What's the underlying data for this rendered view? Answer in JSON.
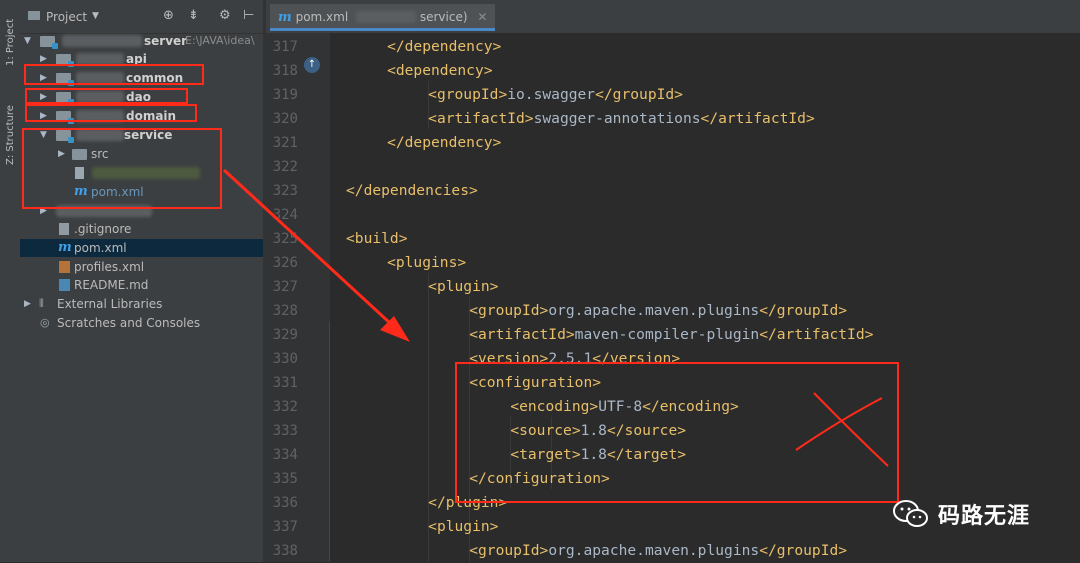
{
  "side_stripe": {
    "project_tab": "1: Project",
    "structure_tab": "Z: Structure"
  },
  "project_panel": {
    "header": {
      "title": "Project"
    },
    "tree": [
      {
        "label": "server",
        "path": "E:\\JAVA\\idea\\"
      },
      {
        "label": "api"
      },
      {
        "label": "common"
      },
      {
        "label": "dao"
      },
      {
        "label": "domain"
      },
      {
        "label": "service"
      },
      {
        "label": "src"
      },
      {
        "label": "pom.xml"
      },
      {
        "label": ".gitignore"
      },
      {
        "label": "pom.xml"
      },
      {
        "label": "profiles.xml"
      },
      {
        "label": "README.md"
      },
      {
        "label": "External Libraries"
      },
      {
        "label": "Scratches and Consoles"
      }
    ]
  },
  "editor_tab": {
    "label": "pom.xml",
    "suffix": "service)"
  },
  "line_numbers": [
    "317",
    "318",
    "319",
    "320",
    "321",
    "322",
    "323",
    "324",
    "325",
    "326",
    "327",
    "328",
    "329",
    "330",
    "331",
    "332",
    "333",
    "334",
    "335",
    "336",
    "337",
    "338"
  ],
  "code_lines": [
    {
      "indent": 4,
      "parts": [
        [
          "tg",
          "</dependency>"
        ]
      ]
    },
    {
      "indent": 4,
      "parts": [
        [
          "tg",
          "<dependency>"
        ]
      ]
    },
    {
      "indent": 8,
      "parts": [
        [
          "tg",
          "<groupId>"
        ],
        [
          "tx",
          "io.swagger"
        ],
        [
          "tg",
          "</groupId>"
        ]
      ]
    },
    {
      "indent": 8,
      "parts": [
        [
          "tg",
          "<artifactId>"
        ],
        [
          "tx",
          "swagger-annotations"
        ],
        [
          "tg",
          "</artifactId>"
        ]
      ]
    },
    {
      "indent": 4,
      "parts": [
        [
          "tg",
          "</dependency>"
        ]
      ]
    },
    {
      "indent": 0,
      "parts": []
    },
    {
      "indent": 0,
      "parts": [
        [
          "tg",
          "</dependencies>"
        ]
      ]
    },
    {
      "indent": 0,
      "parts": []
    },
    {
      "indent": 0,
      "parts": [
        [
          "tg",
          "<build>"
        ]
      ]
    },
    {
      "indent": 4,
      "parts": [
        [
          "tg",
          "<plugins>"
        ]
      ]
    },
    {
      "indent": 8,
      "parts": [
        [
          "tg",
          "<plugin>"
        ]
      ]
    },
    {
      "indent": 12,
      "parts": [
        [
          "tg",
          "<groupId>"
        ],
        [
          "tx",
          "org.apache.maven.plugins"
        ],
        [
          "tg",
          "</groupId>"
        ]
      ]
    },
    {
      "indent": 12,
      "parts": [
        [
          "tg",
          "<artifactId>"
        ],
        [
          "tx",
          "maven-compiler-plugin"
        ],
        [
          "tg",
          "</artifactId>"
        ]
      ]
    },
    {
      "indent": 12,
      "parts": [
        [
          "tg",
          "<version>"
        ],
        [
          "tx",
          "2.5.1"
        ],
        [
          "tg",
          "</version>"
        ]
      ]
    },
    {
      "indent": 12,
      "parts": [
        [
          "tg",
          "<configuration>"
        ]
      ]
    },
    {
      "indent": 16,
      "parts": [
        [
          "tg",
          "<encoding>"
        ],
        [
          "tx",
          "UTF-8"
        ],
        [
          "tg",
          "</encoding>"
        ]
      ]
    },
    {
      "indent": 16,
      "parts": [
        [
          "tg",
          "<source>"
        ],
        [
          "tx",
          "1.8"
        ],
        [
          "tg",
          "</source>"
        ]
      ]
    },
    {
      "indent": 16,
      "parts": [
        [
          "tg",
          "<target>"
        ],
        [
          "tx",
          "1.8"
        ],
        [
          "tg",
          "</target>"
        ]
      ]
    },
    {
      "indent": 12,
      "parts": [
        [
          "tg",
          "</configuration>"
        ]
      ]
    },
    {
      "indent": 8,
      "parts": [
        [
          "tg",
          "</plugin>"
        ]
      ]
    },
    {
      "indent": 8,
      "parts": [
        [
          "tg",
          "<plugin>"
        ]
      ]
    },
    {
      "indent": 12,
      "parts": [
        [
          "tg",
          "<groupId>"
        ],
        [
          "tx",
          "org.apache.maven.plugins"
        ],
        [
          "tg",
          "</groupId>"
        ]
      ]
    }
  ],
  "watermark": {
    "text": "码路无涯"
  },
  "colors": {
    "annotation": "#ff2a1a",
    "tag": "#e8bf6a",
    "text": "#a9b7c6",
    "background": "#2b2b2b"
  }
}
